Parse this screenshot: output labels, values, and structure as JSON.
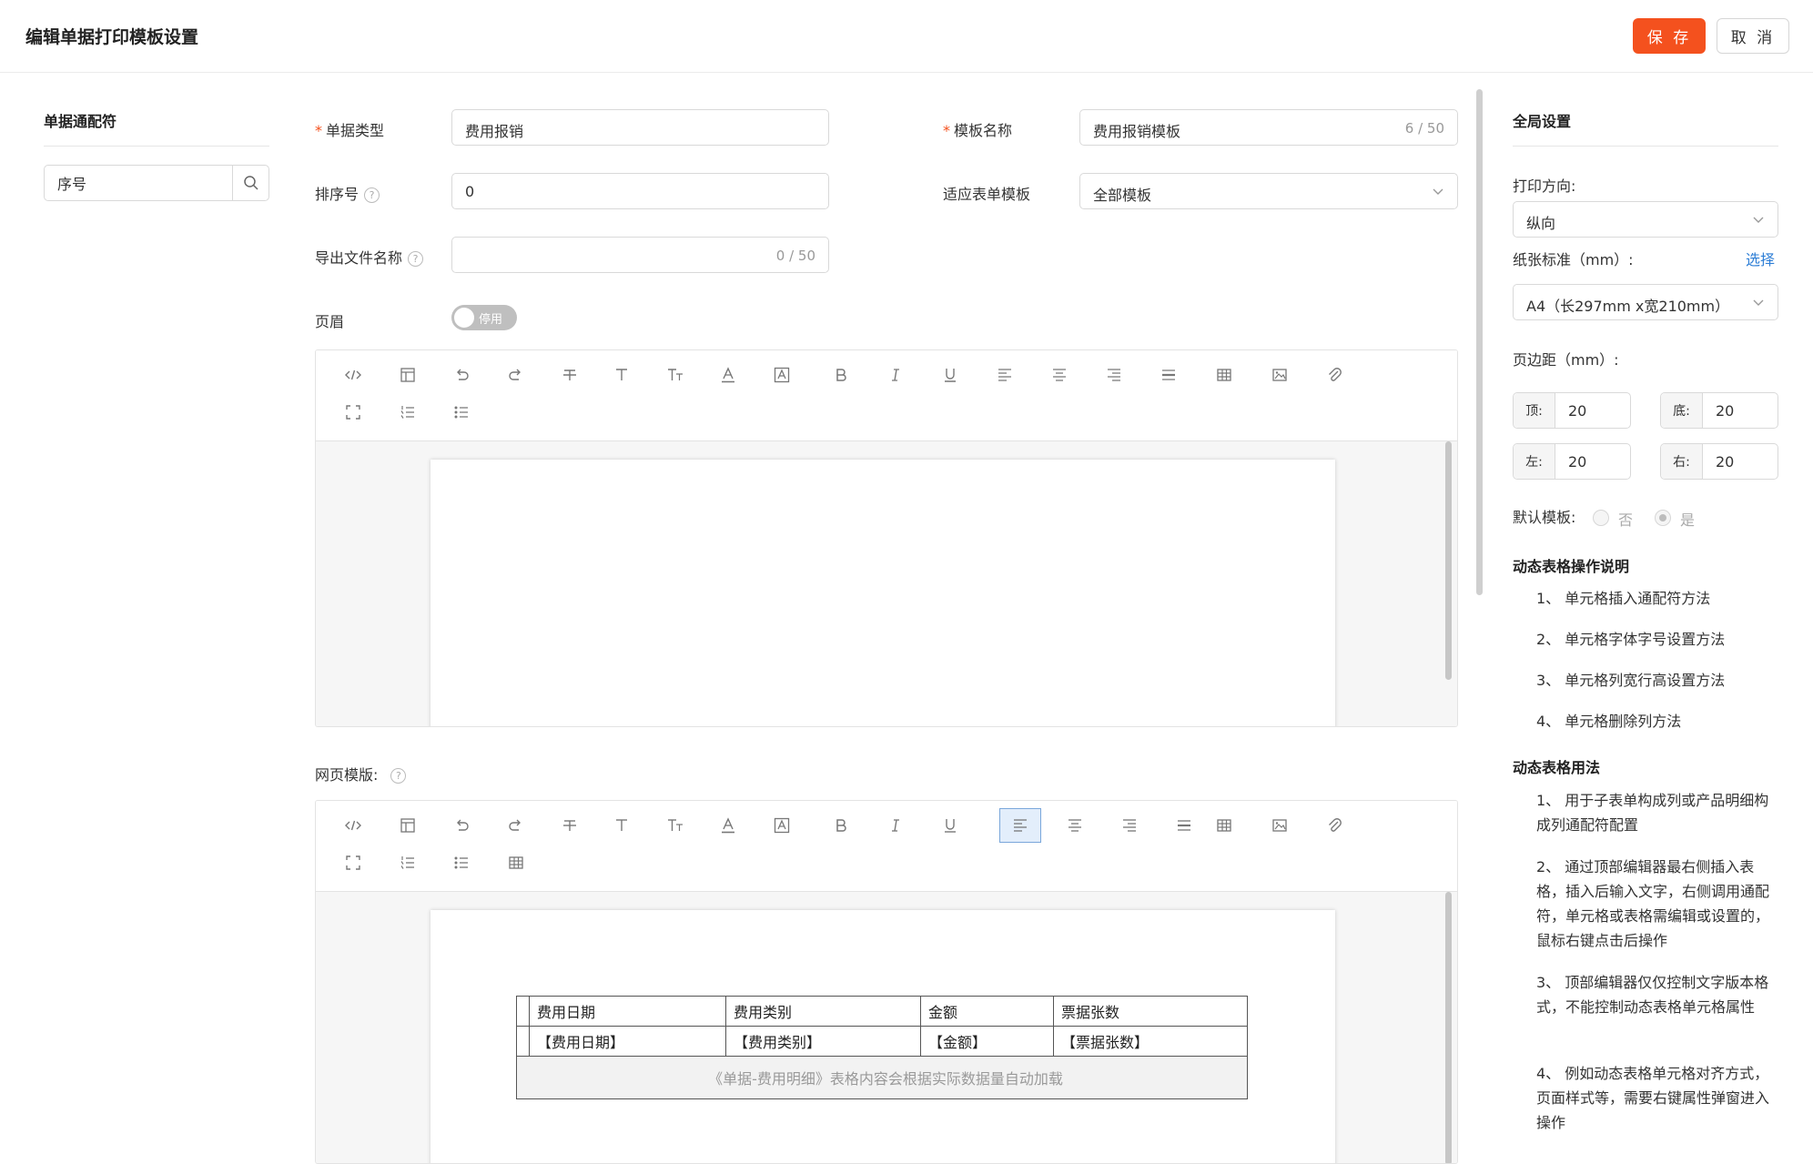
{
  "header": {
    "title": "编辑单据打印模板设置",
    "save_label": "保 存",
    "cancel_label": "取 消"
  },
  "left_panel": {
    "title": "单据通配符",
    "search_value": "序号"
  },
  "form": {
    "doc_type_label": "单据类型",
    "doc_type_value": "费用报销",
    "template_name_label": "模板名称",
    "template_name_value": "费用报销模板",
    "template_name_count": "6 / 50",
    "sort_label": "排序号",
    "sort_value": "0",
    "apply_label": "适应表单模板",
    "apply_value": "全部模板",
    "export_label": "导出文件名称",
    "export_count": "0 / 50",
    "header_label": "页眉",
    "header_toggle": "停用",
    "web_template_label": "网页模版:"
  },
  "icons": {
    "toolbar_row1": [
      "code-view-icon",
      "template-icon",
      "undo-icon",
      "redo-icon",
      "strikethrough-icon",
      "text-format-icon",
      "font-size-icon",
      "font-color-icon",
      "background-color-icon",
      "bold-icon",
      "italic-icon",
      "underline-icon",
      "align-left-icon",
      "align-center-icon",
      "align-right-icon",
      "line-height-icon",
      "table-icon",
      "image-icon",
      "attachment-icon"
    ],
    "toolbar_row2": [
      "fullscreen-icon",
      "ordered-list-icon",
      "unordered-list-icon"
    ]
  },
  "web_table": {
    "headers": [
      "费用日期",
      "费用类别",
      "金额",
      "票据张数"
    ],
    "row": [
      "【费用日期】",
      "【费用类别】",
      "【金额】",
      "【票据张数】"
    ],
    "note": "《单据-费用明细》表格内容会根据实际数据量自动加载"
  },
  "right_panel": {
    "title": "全局设置",
    "orientation_label": "打印方向:",
    "orientation_value": "纵向",
    "paper_label": "纸张标准（mm）:",
    "paper_select_link": "选择",
    "paper_value": "A4（长297mm x宽210mm）",
    "margin_label": "页边距（mm）:",
    "margin_top_label": "顶:",
    "margin_top": "20",
    "margin_bottom_label": "底:",
    "margin_bottom": "20",
    "margin_left_label": "左:",
    "margin_left": "20",
    "margin_right_label": "右:",
    "margin_right": "20",
    "default_label": "默认模板:",
    "default_no": "否",
    "default_yes": "是",
    "default_selected": "是",
    "ops_title": "动态表格操作说明",
    "ops": [
      "1、 单元格插入通配符方法",
      "2、 单元格字体字号设置方法",
      "3、 单元格列宽行高设置方法",
      "4、 单元格删除列方法"
    ],
    "usage_title": "动态表格用法",
    "usage": [
      "1、 用于子表单构成列或产品明细构成列通配符配置",
      "2、 通过顶部编辑器最右侧插入表格，插入后输入文字，右侧调用通配符，单元格或表格需编辑或设置的，鼠标右键点击后操作",
      "3、 顶部编辑器仅仅控制文字版本格式，不能控制动态表格单元格属性",
      "4、 例如动态表格单元格对齐方式，页面样式等，需要右键属性弹窗进入操作"
    ]
  }
}
